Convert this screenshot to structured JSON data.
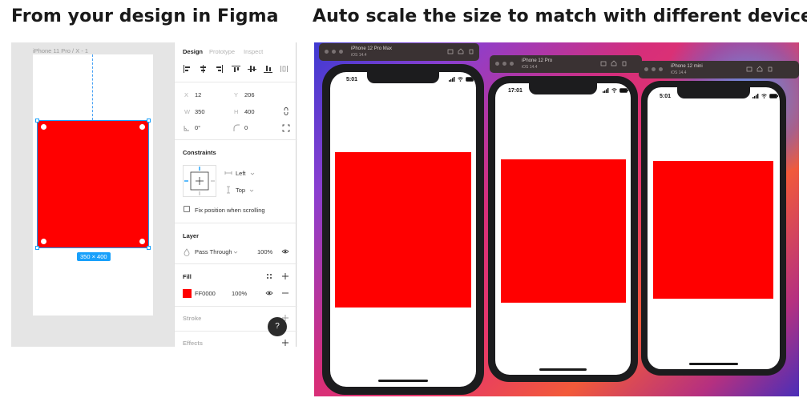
{
  "headings": {
    "left": "From your design in Figma",
    "right": "Auto scale the size to match with different devices"
  },
  "figma": {
    "frame_label": "iPhone 11 Pro / X - 1",
    "size_badge": "350 × 400",
    "tabs": [
      {
        "label": "Design",
        "active": true
      },
      {
        "label": "Prototype",
        "active": false
      },
      {
        "label": "Inspect",
        "active": false
      }
    ],
    "align_icons": [
      "align-left-icon",
      "align-horizontal-center-icon",
      "align-right-icon",
      "align-top-icon",
      "align-vertical-center-icon",
      "align-bottom-icon",
      "distribute-icon"
    ],
    "fields": {
      "x_label": "X",
      "x_value": "12",
      "y_label": "Y",
      "y_value": "206",
      "w_label": "W",
      "w_value": "350",
      "h_label": "H",
      "h_value": "400",
      "rotation_value": "0°",
      "radius_value": "0"
    },
    "constraints": {
      "title": "Constraints",
      "horizontal": "Left",
      "vertical": "Top",
      "fix_position_label": "Fix position when scrolling",
      "fix_position_checked": false
    },
    "layer": {
      "title": "Layer",
      "blend_mode": "Pass Through",
      "opacity": "100%"
    },
    "fill": {
      "title": "Fill",
      "hex": "FF0000",
      "opacity": "100%",
      "color": "#ff0000"
    },
    "stroke_title": "Stroke",
    "effects_title": "Effects",
    "help_label": "?"
  },
  "simulators": [
    {
      "device": "iPhone 12 Pro Max",
      "os": "iOS 14.4",
      "time": "5:01"
    },
    {
      "device": "iPhone 12 Pro",
      "os": "iOS 14.4",
      "time": "17:01"
    },
    {
      "device": "iPhone 12 mini",
      "os": "iOS 14.4",
      "time": "5:01"
    }
  ],
  "colors": {
    "accent": "#18a0fb",
    "shape_fill": "#ff0000",
    "toolbar_dark": "#2c2c2c"
  }
}
